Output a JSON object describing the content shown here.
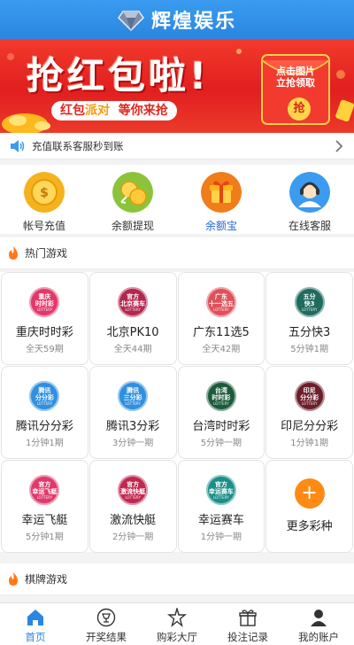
{
  "header": {
    "title": "辉煌娱乐",
    "logo_icon": "diamond-logo-icon"
  },
  "banner": {
    "headline": "抢红包啦!",
    "subline_pre": "红包",
    "subline_highlight": "派对",
    "subline_post": "等你来抢",
    "packet_line1": "点击图片",
    "packet_line2": "立抢领取",
    "packet_button": "抢"
  },
  "notice": {
    "text": "充值联系客服秒到账",
    "icon": "speaker-icon"
  },
  "actions": [
    {
      "label": "帐号充值",
      "icon": "coin-deposit-icon",
      "color": "#f6b21d"
    },
    {
      "label": "余额提现",
      "icon": "coin-withdraw-icon",
      "color": "#8bc43a"
    },
    {
      "label": "余额宝",
      "icon": "gift-box-icon",
      "color": "#f07c1a"
    },
    {
      "label": "在线客服",
      "icon": "customer-service-icon",
      "color": "#3a9bf0"
    }
  ],
  "hot_section": {
    "title": "热门游戏"
  },
  "games": [
    {
      "name": "重庆时时彩",
      "info": "全天59期",
      "badge_top": "重庆",
      "badge_bottom": "时时彩",
      "color": "#e2386a"
    },
    {
      "name": "北京PK10",
      "info": "全天44期",
      "badge_top": "官方",
      "badge_bottom": "北京赛车",
      "color": "#b3264f"
    },
    {
      "name": "广东11选5",
      "info": "全天42期",
      "badge_top": "广东",
      "badge_bottom": "十一选五",
      "color": "#e0505a"
    },
    {
      "name": "五分快3",
      "info": "5分钟1期",
      "badge_top": "五分",
      "badge_bottom": "快3",
      "color": "#1f6b5e"
    },
    {
      "name": "腾讯分分彩",
      "info": "1分钟1期",
      "badge_top": "腾讯",
      "badge_bottom": "分分彩",
      "color": "#2f8fe0"
    },
    {
      "name": "腾讯3分彩",
      "info": "3分钟一期",
      "badge_top": "腾讯",
      "badge_bottom": "三分彩",
      "color": "#2f8fe0"
    },
    {
      "name": "台湾时时彩",
      "info": "5分钟一期",
      "badge_top": "台湾",
      "badge_bottom": "时时彩",
      "color": "#1d5a3b"
    },
    {
      "name": "印尼分分彩",
      "info": "1分钟1期",
      "badge_top": "印尼",
      "badge_bottom": "分分彩",
      "color": "#6b1f2a"
    },
    {
      "name": "幸运飞艇",
      "info": "5分钟1期",
      "badge_top": "官方",
      "badge_bottom": "幸运飞艇",
      "color": "#e2386a"
    },
    {
      "name": "激流快艇",
      "info": "2分钟一期",
      "badge_top": "官方",
      "badge_bottom": "激流快艇",
      "color": "#c2274f"
    },
    {
      "name": "幸运赛车",
      "info": "1分钟一期",
      "badge_top": "官方",
      "badge_bottom": "幸运赛车",
      "color": "#1b8f8a"
    },
    {
      "name": "更多彩种",
      "info": "",
      "badge_top": "",
      "badge_bottom": "",
      "color": "#ff8a14"
    }
  ],
  "badge_footer": "LOTTERY",
  "chess_section": {
    "title": "棋牌游戏"
  },
  "tabs": [
    {
      "label": "首页",
      "icon": "home-icon",
      "active": true
    },
    {
      "label": "开奖结果",
      "icon": "trophy-icon",
      "active": false
    },
    {
      "label": "购彩大厅",
      "icon": "star-person-icon",
      "active": false
    },
    {
      "label": "投注记录",
      "icon": "gift-icon",
      "active": false
    },
    {
      "label": "我的账户",
      "icon": "user-icon",
      "active": false
    }
  ]
}
